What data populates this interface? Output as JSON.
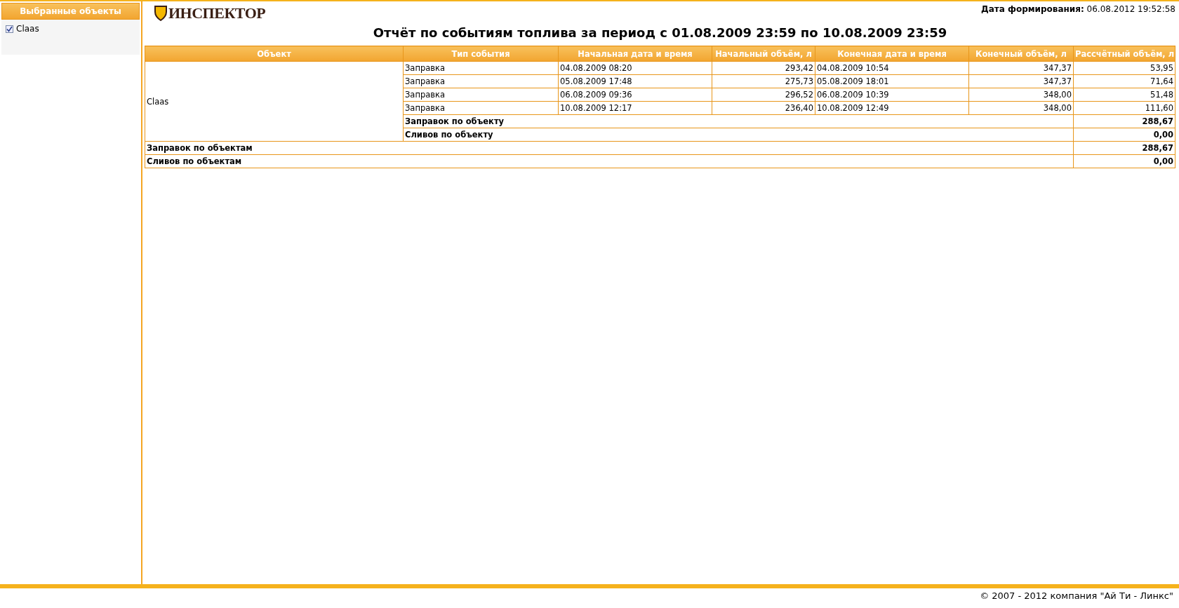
{
  "sidebar": {
    "title": "Выбранные объекты",
    "items": [
      {
        "label": "Claas",
        "checked": true
      }
    ]
  },
  "header": {
    "logo": "ИНСПЕКТОР",
    "generated_label": "Дата формирования:",
    "generated_value": "06.08.2012 19:52:58"
  },
  "report_title": "Отчёт по событиям топлива за период с 01.08.2009 23:59 по 10.08.2009 23:59",
  "table": {
    "columns": [
      "Объект",
      "Тип события",
      "Начальная дата и время",
      "Начальный объём, л",
      "Конечная дата и время",
      "Конечный объём, л",
      "Рассчётный объём, л"
    ],
    "groups": [
      {
        "object": "Claas",
        "rows": [
          [
            "Заправка",
            "04.08.2009 08:20",
            "293,42",
            "04.08.2009 10:54",
            "347,37",
            "53,95"
          ],
          [
            "Заправка",
            "05.08.2009 17:48",
            "275,73",
            "05.08.2009 18:01",
            "347,37",
            "71,64"
          ],
          [
            "Заправка",
            "06.08.2009 09:36",
            "296,52",
            "06.08.2009 10:39",
            "348,00",
            "51,48"
          ],
          [
            "Заправка",
            "10.08.2009 12:17",
            "236,40",
            "10.08.2009 12:49",
            "348,00",
            "111,60"
          ]
        ],
        "subtotals": [
          {
            "label": "Заправок по объекту",
            "value": "288,67"
          },
          {
            "label": "Сливов по объекту",
            "value": "0,00"
          }
        ]
      }
    ],
    "totals": [
      {
        "label": "Заправок по объектам",
        "value": "288,67"
      },
      {
        "label": "Сливов по объектам",
        "value": "0,00"
      }
    ]
  },
  "footer": "© 2007 - 2012 компания \"Ай Ти - Линкс\""
}
